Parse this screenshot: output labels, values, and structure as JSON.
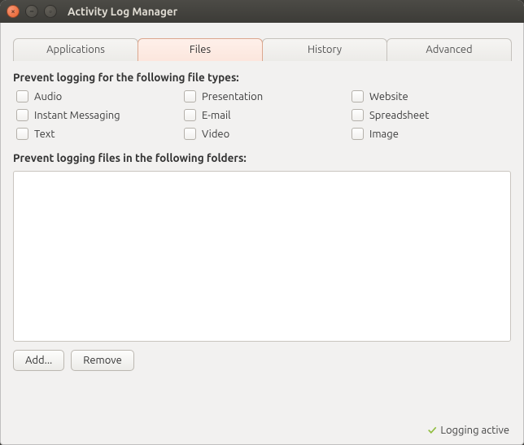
{
  "window": {
    "title": "Activity Log Manager"
  },
  "tabs": {
    "applications": "Applications",
    "files": "Files",
    "history": "History",
    "advanced": "Advanced"
  },
  "sections": {
    "file_types_heading": "Prevent logging for the following file types:",
    "folders_heading": "Prevent logging files in the following folders:"
  },
  "file_types": {
    "audio": "Audio",
    "presentation": "Presentation",
    "website": "Website",
    "instant_messaging": "Instant Messaging",
    "email": "E-mail",
    "spreadsheet": "Spreadsheet",
    "text": "Text",
    "video": "Video",
    "image": "Image"
  },
  "buttons": {
    "add": "Add...",
    "remove": "Remove"
  },
  "status": {
    "text": "Logging active"
  }
}
